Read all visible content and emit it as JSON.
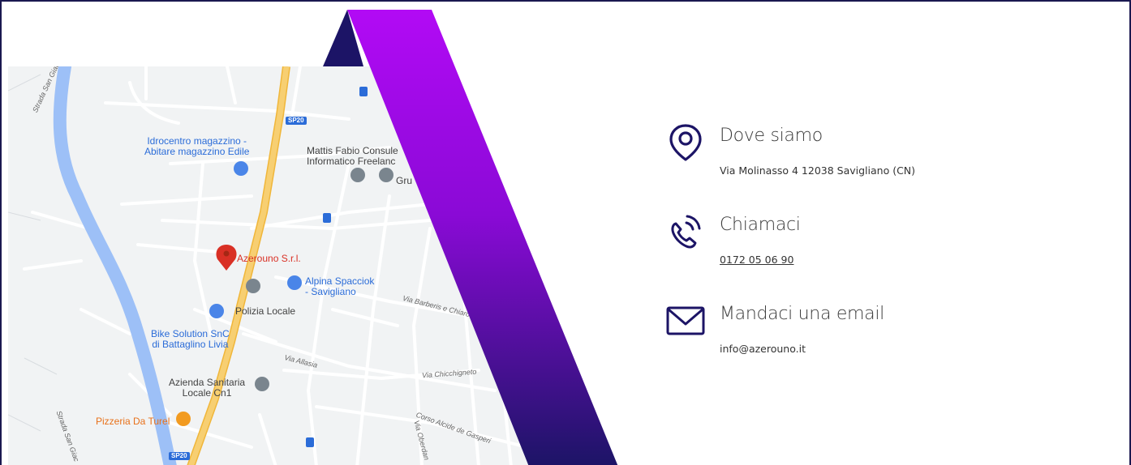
{
  "map": {
    "labels": {
      "idrocentro": "Idrocentro magazzino -\nAbitare magazzino Edile",
      "mattis": "Mattis Fabio Consule\nInformatico Freelanc",
      "grup": "Gru",
      "azerouno": "Azerouno S.r.l.",
      "alpina": "Alpina Spacciok\n- Savigliano",
      "polizia": "Polizia Locale",
      "bike": "Bike Solution SnC\ndi Battaglino Livia",
      "azienda": "Azienda Sanitaria\nLocale Cn1",
      "pizzeria": "Pizzeria Da Turel",
      "sp20_top": "SP20",
      "sp20_bottom": "SP20",
      "road_barberis": "Via Barberis e Chiaro",
      "road_allasia": "Via Allasia",
      "road_chicchigneto": "Via Chicchigneto",
      "road_degasperi": "Corso Alcide de Gasperi",
      "road_sangiac_top": "Strada San Giac",
      "road_sangiac_bottom": "Strada San Giac",
      "road_oberdan": "Via Oberdan"
    }
  },
  "contact": {
    "location": {
      "icon": "location-pin-icon",
      "title": "Dove siamo",
      "text": "Via Molinasso 4 12038 Savigliano (CN)"
    },
    "phone": {
      "icon": "phone-ringing-icon",
      "title": "Chiamaci",
      "text": "0172 05 06 90"
    },
    "email": {
      "icon": "envelope-icon",
      "title": "Mandaci una email",
      "text": "info@azerouno.it"
    }
  },
  "colors": {
    "brand_dark": "#1c1466",
    "brand_purple": "#b20af5",
    "map_bg": "#f1f3f4",
    "river": "#9dc0f7",
    "highway": "#f7cf72"
  }
}
